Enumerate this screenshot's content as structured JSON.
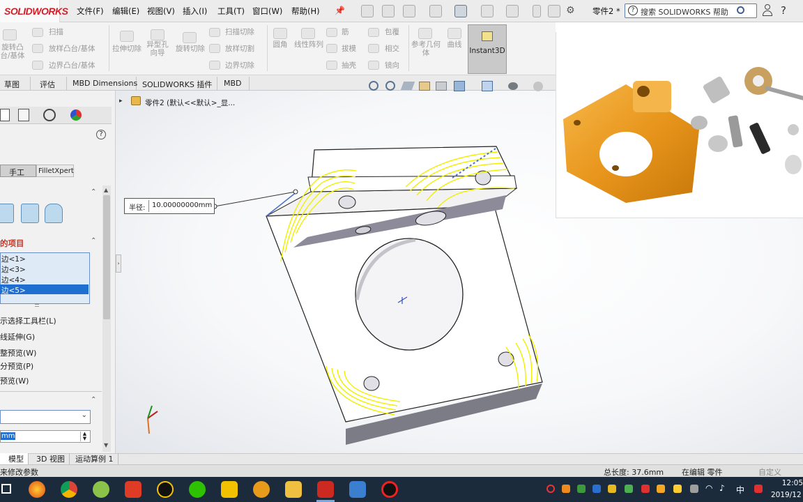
{
  "app": {
    "logo": "SOLIDWORKS"
  },
  "menu": [
    "文件(F)",
    "编辑(E)",
    "视图(V)",
    "插入(I)",
    "工具(T)",
    "窗口(W)",
    "帮助(H)"
  ],
  "document_title": "零件2 *",
  "search_placeholder": "搜索 SOLIDWORKS 帮助",
  "ribbon": {
    "col1": [
      "旋转凸",
      "台/基体"
    ],
    "sweep_boss": "扫描",
    "loft_boss": "放样凸台/基体",
    "boundary_boss": "边界凸台/基体",
    "extruded_cut": "拉伸切除",
    "hole_wizard": "异型孔向导",
    "revolved_cut": "旋转切除",
    "swept_cut": "扫描切除",
    "lofted_cut": "放样切割",
    "boundary_cut": "边界切除",
    "fillet": "圆角",
    "linear_pattern": "线性阵列",
    "rib": "筋",
    "draft": "拔模",
    "shell": "抽壳",
    "wrap": "包覆",
    "intersect": "相交",
    "mirror": "镜向",
    "ref_geometry": "参考几何体",
    "curves": "曲线",
    "instant3d": "Instant3D"
  },
  "cm_tabs": [
    "草图",
    "评估",
    "MBD Dimensions",
    "SOLIDWORKS 插件",
    "MBD"
  ],
  "tree_item": "零件2 (默认<<默认>_显...",
  "property_manager": {
    "help_icon": "?",
    "mode_tabs": [
      "手工",
      "FilletXpert"
    ],
    "items_header": "的项目",
    "items": [
      "&lt;1&gt;",
      "&lt;3&gt;",
      "&lt;4&gt;",
      "&lt;5&gt;"
    ],
    "options": [
      "示选择工具栏(L)",
      "线延伸(G)",
      "整预览(W)",
      "分预览(P)",
      "预览(W)"
    ],
    "radius_value": "mm"
  },
  "callout": {
    "label": "半径:",
    "value": "10.00000000mm"
  },
  "bottom_tabs": [
    "模型",
    "3D 视图",
    "运动算例 1"
  ],
  "status": {
    "left": "来修改参数",
    "length": "总长度: 37.6mm",
    "editing": "在编辑 零件",
    "custom": "自定义"
  },
  "taskbar": {
    "time": "12:05",
    "date": "2019/12",
    "ime": "中"
  },
  "colors": {
    "fillet_preview": "#f0f000",
    "selection": "#1f6fd0",
    "accent_red": "#d0202a",
    "taskbar": "#1b2b3c"
  }
}
